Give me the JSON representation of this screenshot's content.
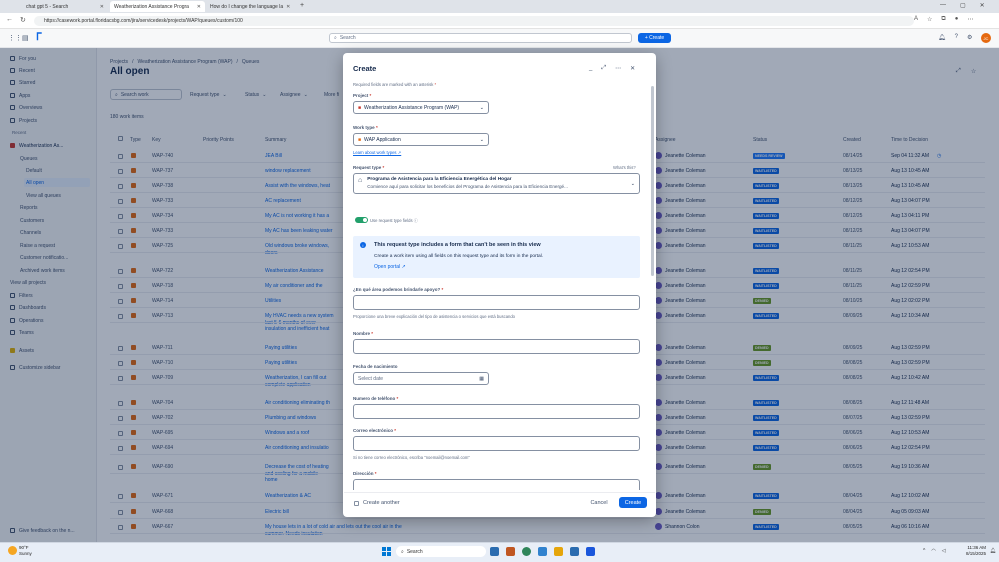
{
  "browser": {
    "tabs": [
      {
        "label": "chat gpt 5 - Search",
        "active": false
      },
      {
        "label": "Weatherization Assistance Progra",
        "active": true
      },
      {
        "label": "How do I change the language la",
        "active": false
      }
    ],
    "url": "https://casework.portal.floridacsbg.com/jira/servicedesk/projects/WAP/queues/custom/100"
  },
  "topbar": {
    "search_placeholder": "Search",
    "create_label": "+ Create",
    "avatar_initials": "JC"
  },
  "sidebar": {
    "items": [
      {
        "label": "For you"
      },
      {
        "label": "Recent"
      },
      {
        "label": "Starred"
      },
      {
        "label": "Apps"
      },
      {
        "label": "Overviews"
      },
      {
        "label": "Projects"
      }
    ],
    "recent_label": "Recent",
    "project_name": "Weatherization As...",
    "sub_items": [
      {
        "label": "Queues"
      },
      {
        "label": "Default"
      },
      {
        "label": "All open"
      },
      {
        "label": "View all queues"
      },
      {
        "label": "Reports"
      },
      {
        "label": "Customers"
      },
      {
        "label": "Channels"
      },
      {
        "label": "Raise a request"
      },
      {
        "label": "Customer notificatio..."
      },
      {
        "label": "Archived work items"
      },
      {
        "label": "View all projects"
      }
    ],
    "bottom_items": [
      {
        "label": "Filters"
      },
      {
        "label": "Dashboards"
      },
      {
        "label": "Operations"
      },
      {
        "label": "Teams"
      }
    ],
    "assets": "Assets",
    "customize": "Customize sidebar",
    "feedback": "Give feedback on the n..."
  },
  "main": {
    "breadcrumbs": [
      "Projects",
      "Weatherization Assistance Program (WAP)",
      "Queues"
    ],
    "title": "All open",
    "search_placeholder": "Search work",
    "filters": [
      "Request type",
      "Status",
      "Assignee",
      "More fi"
    ],
    "work_count": "180 work items",
    "columns": [
      "Type",
      "Key",
      "Priority Points",
      "Summary",
      "Assignee",
      "Status",
      "Created",
      "Time to Decision"
    ],
    "rows": [
      {
        "key": "WAP-740",
        "summary": "JEA Bill",
        "assignee": "Jeanette Coleman",
        "status": "NEEDS REVIEW",
        "created": "08/14/25",
        "ttd": "Sep 04 11:32 AM"
      },
      {
        "key": "WAP-737",
        "summary": "window replacement",
        "assignee": "Jeanette Coleman",
        "status": "WAITLISTED",
        "created": "08/13/25",
        "ttd": "Aug 13 10:45 AM"
      },
      {
        "key": "WAP-738",
        "summary": "Assist with the windows, heat",
        "assignee": "Jeanette Coleman",
        "status": "WAITLISTED",
        "created": "08/13/25",
        "ttd": "Aug 13 10:45 AM"
      },
      {
        "key": "WAP-733",
        "summary": "AC replacement",
        "assignee": "Jeanette Coleman",
        "status": "WAITLISTED",
        "created": "08/12/25",
        "ttd": "Aug 13 04:07 PM"
      },
      {
        "key": "WAP-734",
        "summary": "My AC is not working it has a",
        "assignee": "Jeanette Coleman",
        "status": "WAITLISTED",
        "created": "08/12/25",
        "ttd": "Aug 13 04:11 PM"
      },
      {
        "key": "WAP-733",
        "summary": "My AC has been leaking water",
        "assignee": "Jeanette Coleman",
        "status": "WAITLISTED",
        "created": "08/12/25",
        "ttd": "Aug 13 04:07 PM"
      },
      {
        "key": "WAP-725",
        "summary": "Old windows broke windows,",
        "summary2": "doors",
        "assignee": "Jeanette Coleman",
        "status": "WAITLISTED",
        "created": "08/11/25",
        "ttd": "Aug 12 10:53 AM"
      },
      {
        "key": "WAP-722",
        "summary": "Weatherization Assistance",
        "assignee": "Jeanette Coleman",
        "status": "WAITLISTED",
        "created": "08/11/25",
        "ttd": "Aug 12 02:54 PM"
      },
      {
        "key": "WAP-718",
        "summary": "My air conditioner and the",
        "assignee": "Jeanette Coleman",
        "status": "WAITLISTED",
        "created": "08/11/25",
        "ttd": "Aug 12 02:59 PM"
      },
      {
        "key": "WAP-714",
        "summary": "Utilities",
        "assignee": "Jeanette Coleman",
        "status": "DENIED",
        "created": "08/10/25",
        "ttd": "Aug 12 02:02 PM"
      },
      {
        "key": "WAP-713",
        "summary": "My HVAC needs a new system",
        "summary2": "last 5-6 months of ever",
        "summary3": "insulation and inefficient heat",
        "assignee": "Jeanette Coleman",
        "status": "WAITLISTED",
        "created": "08/09/25",
        "ttd": "Aug 12 10:34 AM"
      },
      {
        "key": "WAP-711",
        "summary": "Paying utilities",
        "assignee": "Jeanette Coleman",
        "status": "DENIED",
        "created": "08/09/25",
        "ttd": "Aug 13 02:59 PM"
      },
      {
        "key": "WAP-710",
        "summary": "Paying utilities",
        "assignee": "Jeanette Coleman",
        "status": "DENIED",
        "created": "08/08/25",
        "ttd": "Aug 13 02:59 PM"
      },
      {
        "key": "WAP-709",
        "summary": "Weatherization, I can fill out",
        "summary2": "complete application",
        "assignee": "Jeanette Coleman",
        "status": "WAITLISTED",
        "created": "08/08/25",
        "ttd": "Aug 12 10:42 AM"
      },
      {
        "key": "WAP-704",
        "summary": "Air conditioning eliminating th",
        "assignee": "Jeanette Coleman",
        "status": "WAITLISTED",
        "created": "08/08/25",
        "ttd": "Aug 12 11:48 AM"
      },
      {
        "key": "WAP-702",
        "summary": "Plumbing and windows",
        "assignee": "Jeanette Coleman",
        "status": "WAITLISTED",
        "created": "08/07/25",
        "ttd": "Aug 13 02:59 PM"
      },
      {
        "key": "WAP-695",
        "summary": "Windows and a roof",
        "assignee": "Jeanette Coleman",
        "status": "WAITLISTED",
        "created": "08/06/25",
        "ttd": "Aug 12 10:53 AM"
      },
      {
        "key": "WAP-694",
        "summary": "Air conditioning and insulatio",
        "assignee": "Jeanette Coleman",
        "status": "WAITLISTED",
        "created": "08/06/25",
        "ttd": "Aug 12 02:54 PM"
      },
      {
        "key": "WAP-690",
        "summary": "Decrease the cost of heating",
        "summary2": "and cooling for a mobile",
        "summary3": "home",
        "assignee": "Jeanette Coleman",
        "status": "DENIED",
        "created": "08/05/25",
        "ttd": "Aug 19 10:36 AM"
      },
      {
        "key": "WAP-671",
        "summary": "Weatherization & AC",
        "assignee": "Jeanette Coleman",
        "status": "WAITLISTED",
        "created": "08/04/25",
        "ttd": "Aug 12 10:02 AM"
      },
      {
        "key": "WAP-668",
        "summary": "Electric bill",
        "assignee": "Jeanette Coleman",
        "status": "DENIED",
        "created": "08/04/25",
        "ttd": "Aug 05 09:03 AM"
      },
      {
        "key": "WAP-667",
        "summary": "My house lets in a lot of cold air and lets out the cool air in the",
        "summary2": "summer. Needs insulation",
        "assignee": "Shannon Colon",
        "status": "WAITLISTED",
        "created": "08/05/25",
        "ttd": "Aug 06 10:16 AM"
      }
    ]
  },
  "modal": {
    "title": "Create",
    "required_note": "Required fields are marked with an asterisk",
    "project_label": "Project",
    "project_value": "Weatherization Assistance Program (WAP)",
    "work_type_label": "Work type",
    "work_type_value": "WAP Application",
    "learn_link": "Learn about work types",
    "request_type_label": "Request type",
    "whats_this": "What's this?",
    "request_type_title": "Programa de Asistencia para la Eficiencia Energética del Hogar",
    "request_type_desc": "Comience aquí para solicitar los beneficios del Programa de Asistencia para la Eficiencia Energé...",
    "toggle_label": "Use request type fields",
    "info_title": "This request type includes a form that can't be seen in this view",
    "info_body": "Create a work item using all fields on this request type and its form in the portal.",
    "info_link": "Open portal",
    "field1_label": "¿En qué área podemos brindarle apoyo?",
    "field1_hint": "Proporcione una breve explicación del tipo de asistencia o servicios que está buscando",
    "field2_label": "Nombre",
    "field3_label": "Fecha de nacimiento",
    "field3_placeholder": "Select date",
    "field4_label": "Numero de teléfono",
    "field5_label": "Correo electrónico",
    "field5_hint": "Si no tiene correo electrónico, escriba \"noemail@noemail.com\"",
    "field6_label": "Dirección",
    "create_another": "Create another",
    "cancel": "Cancel",
    "create": "Create"
  },
  "taskbar": {
    "weather_temp": "90°F",
    "weather_desc": "Sunny",
    "search": "Search",
    "time": "11:36 AM",
    "date": "8/15/2025"
  }
}
